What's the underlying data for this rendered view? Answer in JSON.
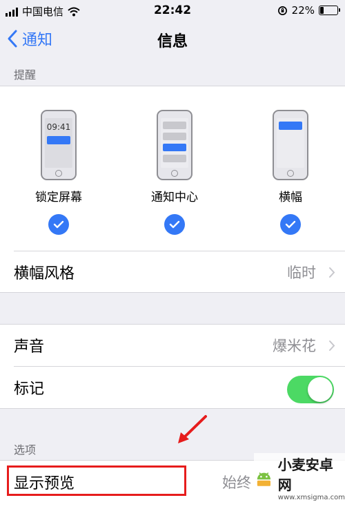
{
  "status_bar": {
    "carrier": "中国电信",
    "time": "22:42",
    "battery": "22%"
  },
  "nav": {
    "back_label": "通知",
    "title": "信息"
  },
  "alerts": {
    "section_label": "提醒",
    "options": [
      {
        "label": "锁定屏幕",
        "preview_time": "09:41",
        "checked": true
      },
      {
        "label": "通知中心",
        "checked": true
      },
      {
        "label": "横幅",
        "checked": true
      }
    ],
    "banner_style": {
      "label": "横幅风格",
      "value": "临时"
    }
  },
  "sound_group": {
    "sound": {
      "label": "声音",
      "value": "爆米花"
    },
    "badge": {
      "label": "标记",
      "enabled": true
    }
  },
  "options_section": {
    "section_label": "选项",
    "show_previews": {
      "label": "显示预览",
      "value": "始终"
    }
  },
  "watermark": {
    "title": "小麦安卓网",
    "url": "www.xmsigma.com"
  },
  "colors": {
    "accent": "#3478f6",
    "toggle_on": "#4cd964",
    "highlight": "#e61c1c"
  }
}
